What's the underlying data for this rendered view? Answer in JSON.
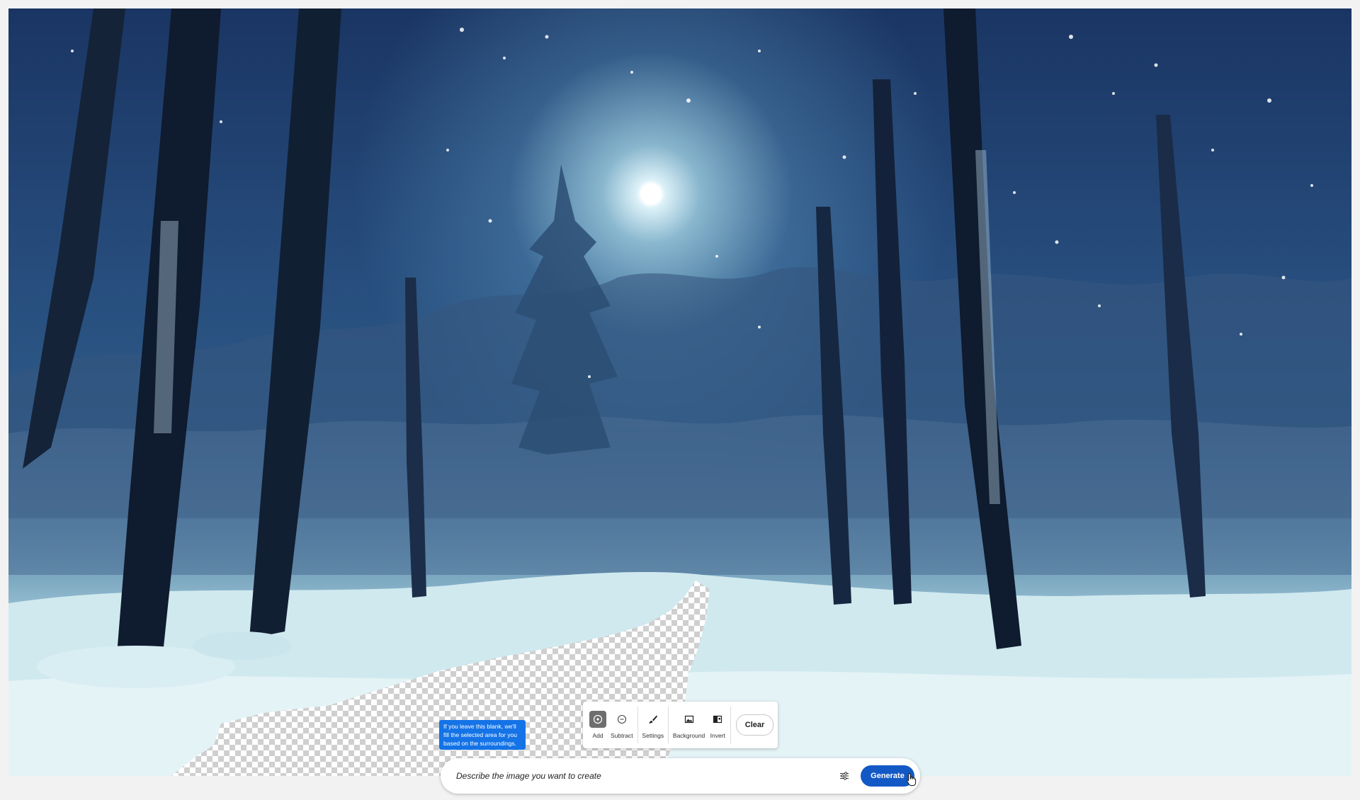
{
  "canvas": {
    "image_description_icon": "photo-canvas",
    "colors": {
      "sky_dark": "#1a3563",
      "glow": "#bfe2ea",
      "snow": "#d6eef2"
    }
  },
  "hint": {
    "text": "If you leave this blank, we'll fill the selected area for you based on the surroundings."
  },
  "toolbar": {
    "tools": [
      {
        "label": "Add",
        "icon": "add-brush-icon",
        "active": true
      },
      {
        "label": "Subtract",
        "icon": "subtract-brush-icon",
        "active": false
      },
      {
        "label": "Settings",
        "icon": "brush-icon",
        "active": false
      },
      {
        "label": "Background",
        "icon": "image-icon",
        "active": false
      },
      {
        "label": "Invert",
        "icon": "invert-icon",
        "active": false
      }
    ],
    "clear_label": "Clear"
  },
  "prompt": {
    "placeholder": "Describe the image you want to create",
    "value": "",
    "options_icon": "sliders-icon",
    "generate_label": "Generate",
    "accent": "#1359c6"
  }
}
